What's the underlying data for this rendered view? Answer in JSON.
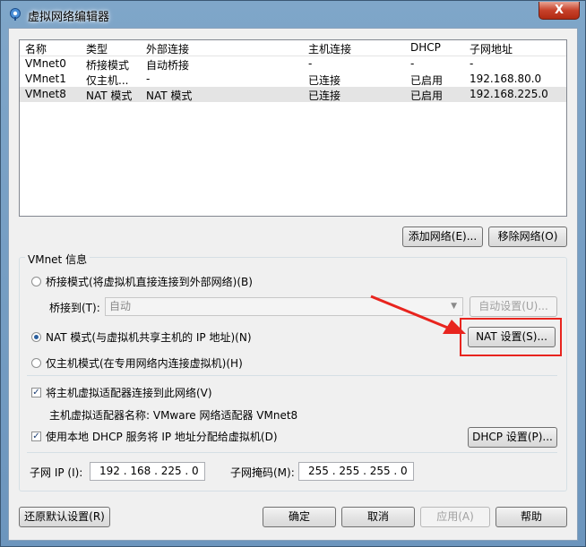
{
  "window": {
    "title": "虚拟网络编辑器",
    "close_glyph": "X",
    "icon": "app-icon"
  },
  "table": {
    "headers": [
      "名称",
      "类型",
      "外部连接",
      "主机连接",
      "DHCP",
      "子网地址"
    ],
    "rows": [
      [
        "VMnet0",
        "桥接模式",
        "自动桥接",
        "-",
        "-",
        "-"
      ],
      [
        "VMnet1",
        "仅主机...",
        "-",
        "已连接",
        "已启用",
        "192.168.80.0"
      ],
      [
        "VMnet8",
        "NAT 模式",
        "NAT 模式",
        "已连接",
        "已启用",
        "192.168.225.0"
      ]
    ],
    "selected_row": 2
  },
  "buttons": {
    "add_network": "添加网络(E)...",
    "remove_network": "移除网络(O)",
    "auto_settings": "自动设置(U)...",
    "nat_settings": "NAT 设置(S)...",
    "dhcp_settings": "DHCP 设置(P)...",
    "restore_defaults": "还原默认设置(R)",
    "ok": "确定",
    "cancel": "取消",
    "apply": "应用(A)",
    "help": "帮助"
  },
  "vmnet_info": {
    "label": "VMnet 信息",
    "bridged_mode": "桥接模式(将虚拟机直接连接到外部网络)(B)",
    "bridged_to_label": "桥接到(T):",
    "bridged_to_value": "自动",
    "nat_mode": "NAT 模式(与虚拟机共享主机的 IP 地址)(N)",
    "host_only_mode": "仅主机模式(在专用网络内连接虚拟机)(H)",
    "selected_mode": "nat",
    "connect_adapter": "将主机虚拟适配器连接到此网络(V)",
    "connect_adapter_checked": true,
    "adapter_name": "主机虚拟适配器名称: VMware 网络适配器 VMnet8",
    "use_dhcp": "使用本地 DHCP 服务将 IP 地址分配给虚拟机(D)",
    "use_dhcp_checked": true,
    "subnet_ip_label": "子网 IP (I):",
    "subnet_ip": "192 . 168 . 225 .  0",
    "subnet_mask_label": "子网掩码(M):",
    "subnet_mask": "255 . 255 . 255 .  0"
  },
  "colors": {
    "annotation": "#e8241e",
    "title_bar": "#6c95bd",
    "close_button": "#c7412a"
  }
}
